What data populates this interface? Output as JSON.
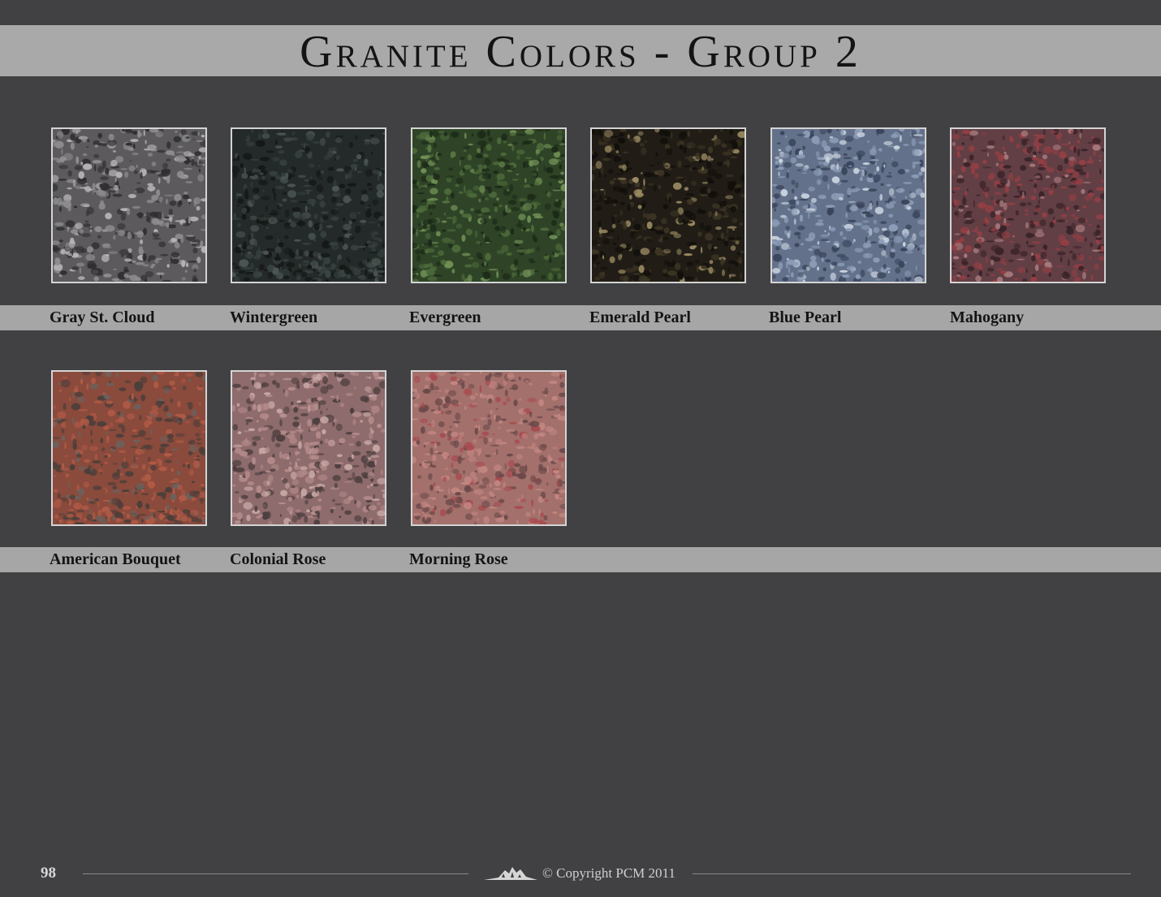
{
  "title": "Granite Colors - Group 2",
  "rows": [
    [
      {
        "name": "Gray St. Cloud",
        "base": "#5c5a5c",
        "c1": "#2f2e30",
        "c2": "#8f8d90",
        "c3": "#b7b3b6",
        "icon": "gray-st-cloud-swatch"
      },
      {
        "name": "Wintergreen",
        "base": "#242a29",
        "c1": "#141817",
        "c2": "#36403e",
        "c3": "#4b5553",
        "icon": "wintergreen-swatch"
      },
      {
        "name": "Evergreen",
        "base": "#2f4427",
        "c1": "#1c2a18",
        "c2": "#4c6a3a",
        "c3": "#6f8f55",
        "icon": "evergreen-swatch"
      },
      {
        "name": "Emerald Pearl",
        "base": "#211d16",
        "c1": "#120f0b",
        "c2": "#3d3524",
        "c3": "#9a8a62",
        "icon": "emerald-pearl-swatch"
      },
      {
        "name": "Blue Pearl",
        "base": "#63718a",
        "c1": "#39445a",
        "c2": "#8c9cb7",
        "c3": "#c9d2de",
        "icon": "blue-pearl-swatch"
      },
      {
        "name": "Mahogany",
        "base": "#623f45",
        "c1": "#3a2429",
        "c2": "#943f44",
        "c3": "#a77a7d",
        "icon": "mahogany-swatch"
      }
    ],
    [
      {
        "name": "American Bouquet",
        "base": "#8a4a3c",
        "c1": "#4c3e3a",
        "c2": "#b05a46",
        "c3": "#6a625e",
        "icon": "american-bouquet-swatch"
      },
      {
        "name": "Colonial Rose",
        "base": "#8e6b6c",
        "c1": "#4e3f40",
        "c2": "#b48a8a",
        "c3": "#c9a9a6",
        "icon": "colonial-rose-swatch"
      },
      {
        "name": "Morning Rose",
        "base": "#a3706c",
        "c1": "#6c4a4a",
        "c2": "#c28681",
        "c3": "#a84b4f",
        "icon": "morning-rose-swatch"
      }
    ]
  ],
  "footer": {
    "page_number": "98",
    "copyright": "© Copyright PCM 2011",
    "logo_icon": "mountain-logo-icon"
  }
}
